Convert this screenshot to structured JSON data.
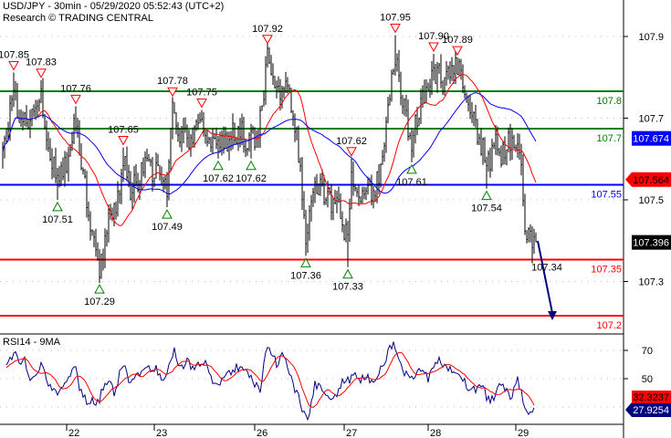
{
  "header": {
    "title": "USD/JPY - 30min - 05/29/2020 05:52:43 (UTC+2)",
    "credit": "Research © TRADING CENTRAL"
  },
  "colors": {
    "support": "#ff0000",
    "resistance": "#008000",
    "pivot": "#0000ff",
    "bars": "#000000",
    "ma_fast": "#ff0000",
    "ma_slow": "#0000ff",
    "rsi": "#000080",
    "rsi_ma": "#ff0000"
  },
  "chart_data": [
    {
      "type": "line",
      "title": "USD/JPY - 30min",
      "subtype": "bar-ohlc",
      "bar_interval": "30min",
      "key_points_bar_price": [
        [
          0,
          107.62
        ],
        [
          3,
          107.7
        ],
        [
          6,
          107.82
        ],
        [
          10,
          107.7
        ],
        [
          15,
          107.74
        ],
        [
          21,
          107.8
        ],
        [
          25,
          107.66
        ],
        [
          30,
          107.55
        ],
        [
          35,
          107.62
        ],
        [
          40,
          107.72
        ],
        [
          45,
          107.55
        ],
        [
          50,
          107.4
        ],
        [
          53,
          107.33
        ],
        [
          58,
          107.45
        ],
        [
          63,
          107.52
        ],
        [
          66,
          107.62
        ],
        [
          70,
          107.53
        ],
        [
          75,
          107.57
        ],
        [
          80,
          107.6
        ],
        [
          85,
          107.58
        ],
        [
          90,
          107.52
        ],
        [
          93,
          107.75
        ],
        [
          97,
          107.68
        ],
        [
          103,
          107.66
        ],
        [
          109,
          107.72
        ],
        [
          115,
          107.66
        ],
        [
          118,
          107.65
        ],
        [
          125,
          107.68
        ],
        [
          130,
          107.69
        ],
        [
          136,
          107.66
        ],
        [
          141,
          107.72
        ],
        [
          145,
          107.88
        ],
        [
          150,
          107.8
        ],
        [
          155,
          107.83
        ],
        [
          159,
          107.75
        ],
        [
          163,
          107.6
        ],
        [
          166,
          107.42
        ],
        [
          170,
          107.56
        ],
        [
          175,
          107.54
        ],
        [
          180,
          107.5
        ],
        [
          185,
          107.47
        ],
        [
          189,
          107.4
        ],
        [
          191,
          107.58
        ],
        [
          197,
          107.52
        ],
        [
          203,
          107.53
        ],
        [
          208,
          107.6
        ],
        [
          212,
          107.78
        ],
        [
          215,
          107.9
        ],
        [
          219,
          107.78
        ],
        [
          224,
          107.66
        ],
        [
          228,
          107.75
        ],
        [
          232,
          107.82
        ],
        [
          236,
          107.86
        ],
        [
          242,
          107.82
        ],
        [
          249,
          107.86
        ],
        [
          253,
          107.8
        ],
        [
          258,
          107.72
        ],
        [
          262,
          107.66
        ],
        [
          265,
          107.6
        ],
        [
          270,
          107.65
        ],
        [
          275,
          107.63
        ],
        [
          279,
          107.68
        ],
        [
          283,
          107.63
        ],
        [
          286,
          107.45
        ],
        [
          289,
          107.4
        ],
        [
          292,
          107.4
        ]
      ],
      "y_ticks": [
        "107.9",
        "107.7",
        "107.5",
        "107.3"
      ],
      "levels": [
        {
          "value": 107.8,
          "label": "107.8",
          "kind": "resistance"
        },
        {
          "value": 107.7,
          "label": "107.7",
          "kind": "resistance"
        },
        {
          "value": 107.55,
          "label": "107.55",
          "kind": "pivot"
        },
        {
          "value": 107.35,
          "label": "107.35",
          "kind": "support"
        },
        {
          "value": 107.2,
          "label": "107.2",
          "kind": "support"
        }
      ],
      "price_tags": [
        {
          "value": 107.674,
          "label": "107.674",
          "color": "#0000ff"
        },
        {
          "value": 107.564,
          "label": "107.564",
          "color": "#ff0000",
          "pointer": true
        },
        {
          "value": 107.396,
          "label": "107.396",
          "color": "#000000"
        }
      ],
      "markers": [
        {
          "bar": 6,
          "price": 107.85,
          "label": "107.85",
          "type": "high"
        },
        {
          "bar": 21,
          "price": 107.83,
          "label": "107.83",
          "type": "high"
        },
        {
          "bar": 40,
          "price": 107.76,
          "label": "107.76",
          "type": "high"
        },
        {
          "bar": 66,
          "price": 107.65,
          "label": "107.65",
          "type": "high"
        },
        {
          "bar": 93,
          "price": 107.78,
          "label": "107.78",
          "type": "high"
        },
        {
          "bar": 109,
          "price": 107.75,
          "label": "107.75",
          "type": "high"
        },
        {
          "bar": 145,
          "price": 107.92,
          "label": "107.92",
          "type": "high"
        },
        {
          "bar": 191,
          "price": 107.62,
          "label": "107.62",
          "type": "high"
        },
        {
          "bar": 215,
          "price": 107.95,
          "label": "107.95",
          "type": "high"
        },
        {
          "bar": 236,
          "price": 107.9,
          "label": "107.90",
          "type": "high"
        },
        {
          "bar": 249,
          "price": 107.89,
          "label": "107.89",
          "type": "high"
        },
        {
          "bar": 30,
          "price": 107.51,
          "label": "107.51",
          "type": "low"
        },
        {
          "bar": 53,
          "price": 107.29,
          "label": "107.29",
          "type": "low"
        },
        {
          "bar": 90,
          "price": 107.49,
          "label": "107.49",
          "type": "low"
        },
        {
          "bar": 118,
          "price": 107.62,
          "label": "107.62",
          "type": "low"
        },
        {
          "bar": 136,
          "price": 107.62,
          "label": "107.62",
          "type": "low"
        },
        {
          "bar": 166,
          "price": 107.36,
          "label": "107.36",
          "type": "low"
        },
        {
          "bar": 189,
          "price": 107.33,
          "label": "107.33",
          "type": "low"
        },
        {
          "bar": 224,
          "price": 107.61,
          "label": "107.61",
          "type": "low"
        },
        {
          "bar": 265,
          "price": 107.54,
          "label": "107.54",
          "type": "low"
        },
        {
          "bar": 290,
          "price": 107.34,
          "label": "107.34",
          "type": "label"
        }
      ],
      "projection": {
        "from_bar": 292,
        "from_price": 107.4,
        "to_bar": 300,
        "to_price": 107.2
      },
      "x_labels": [
        {
          "bar": 35,
          "label": "22"
        },
        {
          "bar": 83,
          "label": "23"
        },
        {
          "bar": 138,
          "label": "26"
        },
        {
          "bar": 187,
          "label": "27"
        },
        {
          "bar": 233,
          "label": "28"
        },
        {
          "bar": 281,
          "label": "29"
        }
      ]
    },
    {
      "type": "line",
      "title": "RSI14 - 9MA",
      "ylim": [
        15,
        80
      ],
      "y_ticks": [
        "70",
        "50"
      ],
      "key_points_bar_value": [
        [
          2,
          57
        ],
        [
          6,
          70
        ],
        [
          9,
          60
        ],
        [
          12,
          62
        ],
        [
          15,
          46
        ],
        [
          21,
          60
        ],
        [
          24,
          48
        ],
        [
          30,
          37
        ],
        [
          34,
          49
        ],
        [
          40,
          58
        ],
        [
          42,
          42
        ],
        [
          47,
          33
        ],
        [
          53,
          34
        ],
        [
          56,
          50
        ],
        [
          61,
          41
        ],
        [
          66,
          61
        ],
        [
          69,
          46
        ],
        [
          77,
          58
        ],
        [
          84,
          57
        ],
        [
          88,
          50
        ],
        [
          94,
          72
        ],
        [
          97,
          57
        ],
        [
          101,
          63
        ],
        [
          105,
          55
        ],
        [
          110,
          63
        ],
        [
          115,
          49
        ],
        [
          119,
          48
        ],
        [
          128,
          58
        ],
        [
          132,
          55
        ],
        [
          141,
          43
        ],
        [
          145,
          75
        ],
        [
          150,
          60
        ],
        [
          154,
          69
        ],
        [
          159,
          47
        ],
        [
          163,
          33
        ],
        [
          167,
          18
        ],
        [
          171,
          45
        ],
        [
          176,
          41
        ],
        [
          181,
          34
        ],
        [
          185,
          46
        ],
        [
          192,
          51
        ],
        [
          198,
          50
        ],
        [
          205,
          49
        ],
        [
          211,
          69
        ],
        [
          214,
          75
        ],
        [
          218,
          58
        ],
        [
          224,
          49
        ],
        [
          229,
          58
        ],
        [
          233,
          50
        ],
        [
          238,
          64
        ],
        [
          242,
          57
        ],
        [
          249,
          57
        ],
        [
          256,
          41
        ],
        [
          262,
          45
        ],
        [
          267,
          33
        ],
        [
          273,
          46
        ],
        [
          278,
          36
        ],
        [
          282,
          52
        ],
        [
          286,
          27.5
        ],
        [
          291,
          28
        ]
      ],
      "value_tags": [
        {
          "label": "32.3237",
          "color": "#ff0000"
        },
        {
          "label": "27.9254",
          "color": "#000080",
          "pointer": true
        }
      ]
    }
  ]
}
